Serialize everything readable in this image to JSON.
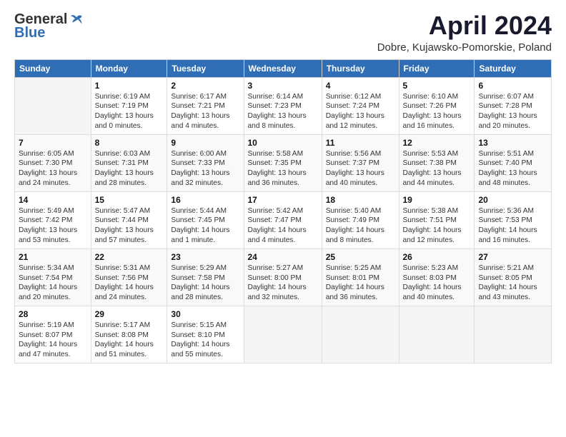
{
  "header": {
    "logo_general": "General",
    "logo_blue": "Blue",
    "title": "April 2024",
    "location": "Dobre, Kujawsko-Pomorskie, Poland"
  },
  "weekdays": [
    "Sunday",
    "Monday",
    "Tuesday",
    "Wednesday",
    "Thursday",
    "Friday",
    "Saturday"
  ],
  "rows": [
    [
      {
        "day": "",
        "sunrise": "",
        "sunset": "",
        "daylight": ""
      },
      {
        "day": "1",
        "sunrise": "Sunrise: 6:19 AM",
        "sunset": "Sunset: 7:19 PM",
        "daylight": "Daylight: 13 hours and 0 minutes."
      },
      {
        "day": "2",
        "sunrise": "Sunrise: 6:17 AM",
        "sunset": "Sunset: 7:21 PM",
        "daylight": "Daylight: 13 hours and 4 minutes."
      },
      {
        "day": "3",
        "sunrise": "Sunrise: 6:14 AM",
        "sunset": "Sunset: 7:23 PM",
        "daylight": "Daylight: 13 hours and 8 minutes."
      },
      {
        "day": "4",
        "sunrise": "Sunrise: 6:12 AM",
        "sunset": "Sunset: 7:24 PM",
        "daylight": "Daylight: 13 hours and 12 minutes."
      },
      {
        "day": "5",
        "sunrise": "Sunrise: 6:10 AM",
        "sunset": "Sunset: 7:26 PM",
        "daylight": "Daylight: 13 hours and 16 minutes."
      },
      {
        "day": "6",
        "sunrise": "Sunrise: 6:07 AM",
        "sunset": "Sunset: 7:28 PM",
        "daylight": "Daylight: 13 hours and 20 minutes."
      }
    ],
    [
      {
        "day": "7",
        "sunrise": "Sunrise: 6:05 AM",
        "sunset": "Sunset: 7:30 PM",
        "daylight": "Daylight: 13 hours and 24 minutes."
      },
      {
        "day": "8",
        "sunrise": "Sunrise: 6:03 AM",
        "sunset": "Sunset: 7:31 PM",
        "daylight": "Daylight: 13 hours and 28 minutes."
      },
      {
        "day": "9",
        "sunrise": "Sunrise: 6:00 AM",
        "sunset": "Sunset: 7:33 PM",
        "daylight": "Daylight: 13 hours and 32 minutes."
      },
      {
        "day": "10",
        "sunrise": "Sunrise: 5:58 AM",
        "sunset": "Sunset: 7:35 PM",
        "daylight": "Daylight: 13 hours and 36 minutes."
      },
      {
        "day": "11",
        "sunrise": "Sunrise: 5:56 AM",
        "sunset": "Sunset: 7:37 PM",
        "daylight": "Daylight: 13 hours and 40 minutes."
      },
      {
        "day": "12",
        "sunrise": "Sunrise: 5:53 AM",
        "sunset": "Sunset: 7:38 PM",
        "daylight": "Daylight: 13 hours and 44 minutes."
      },
      {
        "day": "13",
        "sunrise": "Sunrise: 5:51 AM",
        "sunset": "Sunset: 7:40 PM",
        "daylight": "Daylight: 13 hours and 48 minutes."
      }
    ],
    [
      {
        "day": "14",
        "sunrise": "Sunrise: 5:49 AM",
        "sunset": "Sunset: 7:42 PM",
        "daylight": "Daylight: 13 hours and 53 minutes."
      },
      {
        "day": "15",
        "sunrise": "Sunrise: 5:47 AM",
        "sunset": "Sunset: 7:44 PM",
        "daylight": "Daylight: 13 hours and 57 minutes."
      },
      {
        "day": "16",
        "sunrise": "Sunrise: 5:44 AM",
        "sunset": "Sunset: 7:45 PM",
        "daylight": "Daylight: 14 hours and 1 minute."
      },
      {
        "day": "17",
        "sunrise": "Sunrise: 5:42 AM",
        "sunset": "Sunset: 7:47 PM",
        "daylight": "Daylight: 14 hours and 4 minutes."
      },
      {
        "day": "18",
        "sunrise": "Sunrise: 5:40 AM",
        "sunset": "Sunset: 7:49 PM",
        "daylight": "Daylight: 14 hours and 8 minutes."
      },
      {
        "day": "19",
        "sunrise": "Sunrise: 5:38 AM",
        "sunset": "Sunset: 7:51 PM",
        "daylight": "Daylight: 14 hours and 12 minutes."
      },
      {
        "day": "20",
        "sunrise": "Sunrise: 5:36 AM",
        "sunset": "Sunset: 7:53 PM",
        "daylight": "Daylight: 14 hours and 16 minutes."
      }
    ],
    [
      {
        "day": "21",
        "sunrise": "Sunrise: 5:34 AM",
        "sunset": "Sunset: 7:54 PM",
        "daylight": "Daylight: 14 hours and 20 minutes."
      },
      {
        "day": "22",
        "sunrise": "Sunrise: 5:31 AM",
        "sunset": "Sunset: 7:56 PM",
        "daylight": "Daylight: 14 hours and 24 minutes."
      },
      {
        "day": "23",
        "sunrise": "Sunrise: 5:29 AM",
        "sunset": "Sunset: 7:58 PM",
        "daylight": "Daylight: 14 hours and 28 minutes."
      },
      {
        "day": "24",
        "sunrise": "Sunrise: 5:27 AM",
        "sunset": "Sunset: 8:00 PM",
        "daylight": "Daylight: 14 hours and 32 minutes."
      },
      {
        "day": "25",
        "sunrise": "Sunrise: 5:25 AM",
        "sunset": "Sunset: 8:01 PM",
        "daylight": "Daylight: 14 hours and 36 minutes."
      },
      {
        "day": "26",
        "sunrise": "Sunrise: 5:23 AM",
        "sunset": "Sunset: 8:03 PM",
        "daylight": "Daylight: 14 hours and 40 minutes."
      },
      {
        "day": "27",
        "sunrise": "Sunrise: 5:21 AM",
        "sunset": "Sunset: 8:05 PM",
        "daylight": "Daylight: 14 hours and 43 minutes."
      }
    ],
    [
      {
        "day": "28",
        "sunrise": "Sunrise: 5:19 AM",
        "sunset": "Sunset: 8:07 PM",
        "daylight": "Daylight: 14 hours and 47 minutes."
      },
      {
        "day": "29",
        "sunrise": "Sunrise: 5:17 AM",
        "sunset": "Sunset: 8:08 PM",
        "daylight": "Daylight: 14 hours and 51 minutes."
      },
      {
        "day": "30",
        "sunrise": "Sunrise: 5:15 AM",
        "sunset": "Sunset: 8:10 PM",
        "daylight": "Daylight: 14 hours and 55 minutes."
      },
      {
        "day": "",
        "sunrise": "",
        "sunset": "",
        "daylight": ""
      },
      {
        "day": "",
        "sunrise": "",
        "sunset": "",
        "daylight": ""
      },
      {
        "day": "",
        "sunrise": "",
        "sunset": "",
        "daylight": ""
      },
      {
        "day": "",
        "sunrise": "",
        "sunset": "",
        "daylight": ""
      }
    ]
  ]
}
